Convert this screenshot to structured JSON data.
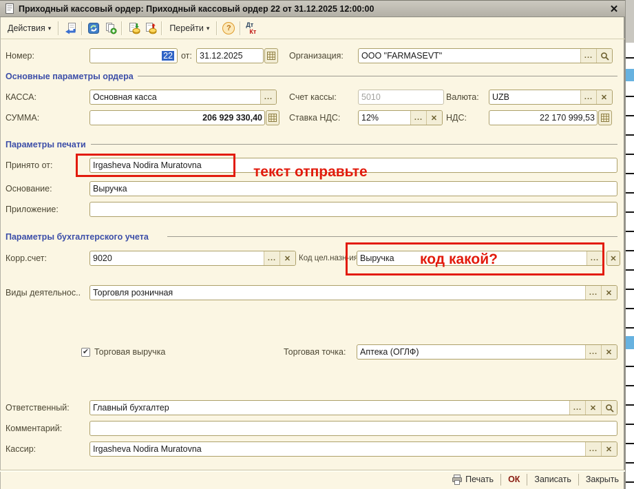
{
  "window": {
    "title": "Приходный кассовый ордер: Приходный кассовый ордер 22 от 31.12.2025 12:00:00"
  },
  "icons": {
    "close": "✕",
    "ellipsis": "...",
    "clear": "✕",
    "dropdown": "▾",
    "check": "✔",
    "help": "?",
    "dt": "Дт",
    "kt": "Кт"
  },
  "toolbar": {
    "actions": "Действия",
    "goto": "Перейти"
  },
  "form": {
    "nomer_label": "Номер:",
    "nomer_value": "22",
    "date_label": "от:",
    "date_value": "31.12.2025",
    "org_label": "Организация:",
    "org_value": "ООО \"FARMASEVT\"",
    "section_main": "Основные параметры ордера",
    "kassa_label": "КАССА:",
    "kassa_value": "Основная касса",
    "schet_label": "Счет кассы:",
    "schet_value": "5010",
    "valuta_label": "Валюта:",
    "valuta_value": "UZB",
    "summa_label": "СУММА:",
    "summa_value": "206 929 330,40",
    "stavka_label": "Ставка НДС:",
    "stavka_value": "12%",
    "nds_label": "НДС:",
    "nds_value": "22 170 999,53",
    "section_print": "Параметры печати",
    "prinyato_label": "Принято от:",
    "prinyato_value": "Irgasheva Nodira Muratovna",
    "osnovanie_label": "Основание:",
    "osnovanie_value": "Выручка",
    "prilozhenie_label": "Приложение:",
    "prilozhenie_value": "",
    "section_buh": "Параметры бухгалтерского учета",
    "korr_label": "Корр.счет:",
    "korr_value": "9020",
    "kod_label": "Код цел.назн-ия:",
    "kod_value": "Выручка",
    "vidy_label": "Виды деятельнос..",
    "vidy_value": "Торговля розничная",
    "torg_check_label": "Торговая выручка",
    "torg_tochka_label": "Торговая точка:",
    "torg_tochka_value": "Аптека (ОГЛФ)",
    "otv_label": "Ответственный:",
    "otv_value": "Главный бухгалтер",
    "komment_label": "Комментарий:",
    "komment_value": "",
    "kassir_label": "Кассир:",
    "kassir_value": "Irgasheva Nodira Muratovna"
  },
  "annotations": {
    "note_text": "текст отправьте",
    "note_kod": "код какой?"
  },
  "footer": {
    "print": "Печать",
    "ok": "ОК",
    "save": "Записать",
    "close": "Закрыть"
  }
}
